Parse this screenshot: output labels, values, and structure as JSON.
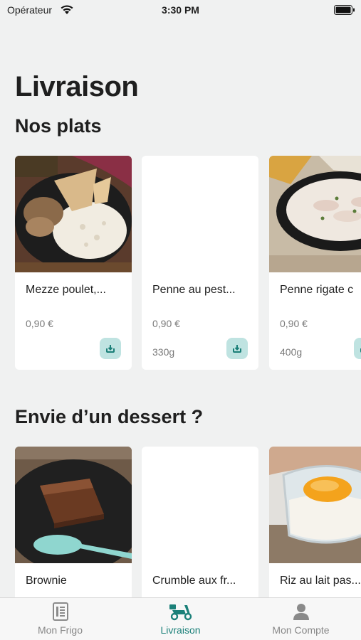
{
  "status_bar": {
    "carrier": "Opérateur",
    "time": "3:30 PM"
  },
  "page_title": "Livraison",
  "sections": [
    {
      "title": "Nos plats",
      "items": [
        {
          "name": "Mezze poulet,...",
          "price": "0,90 €",
          "weight": "",
          "image": "chicken-rice-plate"
        },
        {
          "name": "Penne au pest...",
          "price": "0,90 €",
          "weight": "330g",
          "image": ""
        },
        {
          "name": "Penne rigate c",
          "price": "0,90 €",
          "weight": "400g",
          "image": "penne-bowl"
        }
      ]
    },
    {
      "title": "Envie d’un dessert ?",
      "items": [
        {
          "name": "Brownie",
          "image": "brownie-plate"
        },
        {
          "name": "Crumble aux fr...",
          "image": ""
        },
        {
          "name": "Riz au lait pas...",
          "image": "rice-pudding-jar"
        }
      ]
    }
  ],
  "tab_bar": {
    "tabs": [
      {
        "label": "Mon Frigo",
        "icon": "fridge-icon"
      },
      {
        "label": "Livraison",
        "icon": "scooter-icon",
        "active": true
      },
      {
        "label": "Mon Compte",
        "icon": "person-icon"
      }
    ]
  },
  "colors": {
    "accent": "#1b8079",
    "add_button_bg": "#bfe3e1",
    "background": "#f0f1f1"
  }
}
